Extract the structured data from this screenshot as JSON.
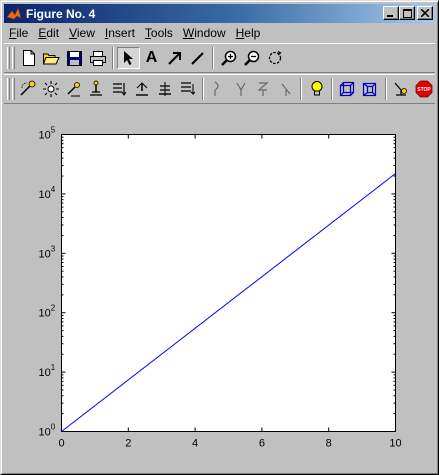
{
  "window": {
    "title": "Figure No. 4",
    "controls": {
      "minimize": "_",
      "maximize": "□",
      "close": "✕"
    }
  },
  "menu": {
    "items": [
      {
        "label": "File",
        "u": "F",
        "rest": "ile"
      },
      {
        "label": "Edit",
        "u": "E",
        "rest": "dit"
      },
      {
        "label": "View",
        "u": "V",
        "rest": "iew"
      },
      {
        "label": "Insert",
        "u": "I",
        "rest": "nsert"
      },
      {
        "label": "Tools",
        "u": "T",
        "rest": "ools"
      },
      {
        "label": "Window",
        "u": "W",
        "rest": "indow"
      },
      {
        "label": "Help",
        "u": "H",
        "rest": "elp"
      }
    ]
  },
  "toolbar1": {
    "buttons": [
      "new-file",
      "open-folder",
      "save",
      "print",
      "select-arrow",
      "insert-text",
      "insert-arrow",
      "insert-line",
      "zoom-in",
      "zoom-out",
      "rotate-3d"
    ],
    "text_button_label": "A"
  },
  "toolbar2": {
    "buttons": [
      "camera-orbit",
      "camera-orbit-light",
      "camera-pan",
      "camera-dolly",
      "camera-move",
      "camera-zoom",
      "camera-roll",
      "camera-walk",
      "x-principal-axis",
      "y-principal-axis",
      "z-principal-axis",
      "no-principal-axis",
      "light-toggle",
      "projection-orthographic",
      "projection-perspective",
      "reset-camera",
      "stop-camera"
    ],
    "stop_label": "STOP"
  },
  "chart_data": {
    "type": "line",
    "title": "",
    "xlabel": "",
    "ylabel": "",
    "yscale": "log",
    "xlim": [
      0,
      10
    ],
    "ylim": [
      1,
      100000
    ],
    "x_ticks": [
      "0",
      "2",
      "4",
      "6",
      "8",
      "10"
    ],
    "y_ticks": [
      {
        "base": "10",
        "exp": "0"
      },
      {
        "base": "10",
        "exp": "1"
      },
      {
        "base": "10",
        "exp": "2"
      },
      {
        "base": "10",
        "exp": "3"
      },
      {
        "base": "10",
        "exp": "4"
      },
      {
        "base": "10",
        "exp": "5"
      }
    ],
    "series": [
      {
        "color": "#0000ff",
        "x": [
          0,
          10
        ],
        "y": [
          1,
          22026
        ]
      }
    ],
    "grid": false,
    "box": true
  }
}
